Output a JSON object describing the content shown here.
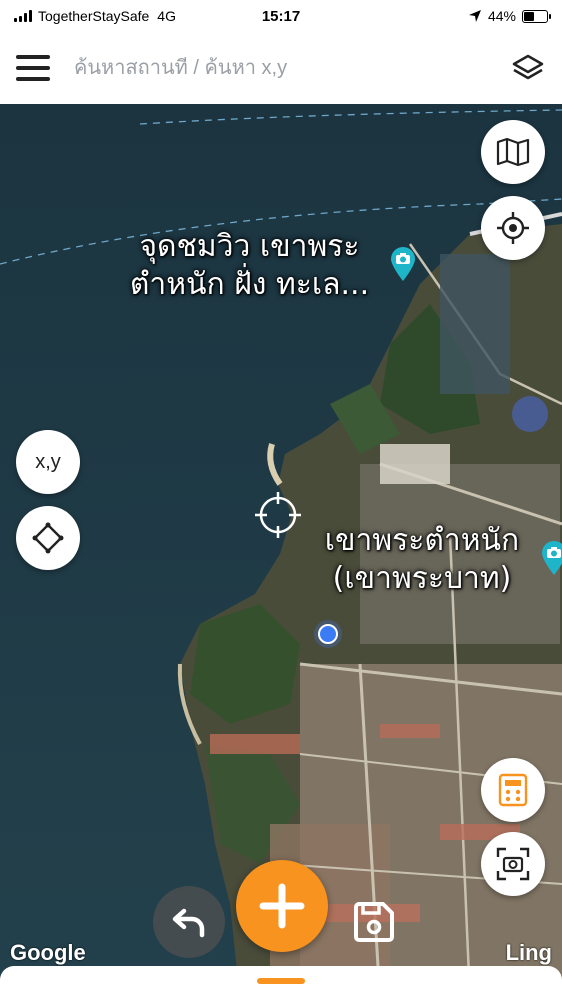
{
  "status_bar": {
    "carrier": "TogetherStaySafe",
    "network": "4G",
    "time": "15:17",
    "battery": "44%",
    "battery_level": 0.44
  },
  "search": {
    "placeholder": "ค้นหาสถานที่ / ค้นหา x,y"
  },
  "map": {
    "labels": {
      "viewpoint": "จุดชมวิว เขาพระ\nตำหนัก ฝั่ง ทะเล...",
      "temple": "เขาพระตำหนัก\n(เขาพระบาท)"
    },
    "xy_button_label": "x,y",
    "attribution": "Google",
    "brand": "Ling"
  },
  "icons": {
    "map_type": "folded-map-icon",
    "locate": "target-icon",
    "layers": "layers-icon",
    "diamond": "diamond-icon",
    "calculator": "calculator-icon",
    "screen_capture": "capture-icon",
    "undo": "undo-icon",
    "add": "plus-icon",
    "save": "save-icon",
    "poi": "camera-pin-icon"
  },
  "colors": {
    "accent": "#f7931e",
    "pin": "#1fb5c9",
    "location": "#3b7bf6"
  }
}
